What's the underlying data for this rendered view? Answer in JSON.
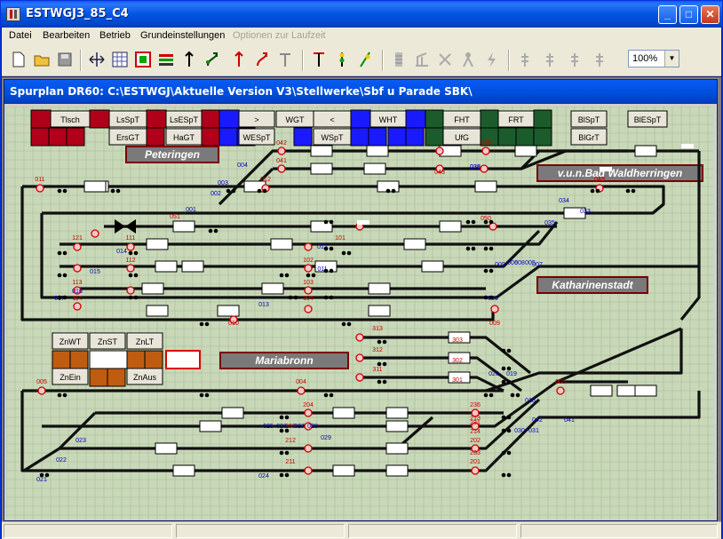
{
  "window": {
    "title": "ESTWGJ3_85_C4"
  },
  "menu": [
    {
      "label": "Datei",
      "enabled": true
    },
    {
      "label": "Bearbeiten",
      "enabled": true
    },
    {
      "label": "Betrieb",
      "enabled": true
    },
    {
      "label": "Grundeinstellungen",
      "enabled": true
    },
    {
      "label": "Optionen zur Laufzeit",
      "enabled": false
    }
  ],
  "toolbar": {
    "zoom": "100%"
  },
  "child": {
    "title": "Spurplan DR60: C:\\ESTWGJ\\Aktuelle Version V3\\Stellwerke\\Sbf u Parade SBK\\"
  },
  "panel": {
    "top_buttons_row1": [
      "Tlsch",
      "LsSpT",
      "LsESpT",
      ">",
      "WGT",
      "<",
      "WHT",
      "FHT",
      "FRT",
      "BlSpT",
      "BlESpT"
    ],
    "top_buttons_row2": [
      "ErsGT",
      "HaGT",
      "WESpT",
      "WSpT",
      "UfG",
      "BlGrT"
    ],
    "left_buttons": [
      "ZnWT",
      "ZnST",
      "ZnLT",
      "ZnEin",
      "ZnAus"
    ],
    "station_labels": [
      "Peteringen",
      "v.u.n.Bad Waldherringen",
      "Katharinenstadt",
      "Mariabronn"
    ],
    "signal_labels": [
      "042",
      "041",
      "046",
      "043",
      "045",
      "011",
      "012",
      "013",
      "051",
      "050",
      "121",
      "111",
      "101",
      "112",
      "102",
      "113",
      "103",
      "114",
      "104",
      "010",
      "009",
      "313",
      "312",
      "311",
      "303",
      "302",
      "301",
      "005",
      "004",
      "003",
      "236",
      "213",
      "203",
      "212",
      "202",
      "211",
      "201",
      "231",
      "233",
      "204",
      "214"
    ],
    "switch_labels": [
      "004",
      "003",
      "002",
      "001",
      "014",
      "015",
      "016",
      "017",
      "013",
      "012",
      "011",
      "005",
      "006",
      "010",
      "035",
      "034",
      "033",
      "036",
      "038",
      "020",
      "019",
      "018",
      "042",
      "041",
      "030",
      "031",
      "023",
      "022",
      "021",
      "024",
      "025",
      "026",
      "027",
      "028",
      "029",
      "009",
      "008",
      "007"
    ]
  },
  "colors": {
    "grid_bg": "#c8d8b8",
    "track": "#101010",
    "red_field": "#b0001a",
    "blue_field": "#1a1aff",
    "green_field": "#1c5c2c",
    "orange_field": "#c05c10",
    "station_bg": "#7a7a7a"
  }
}
